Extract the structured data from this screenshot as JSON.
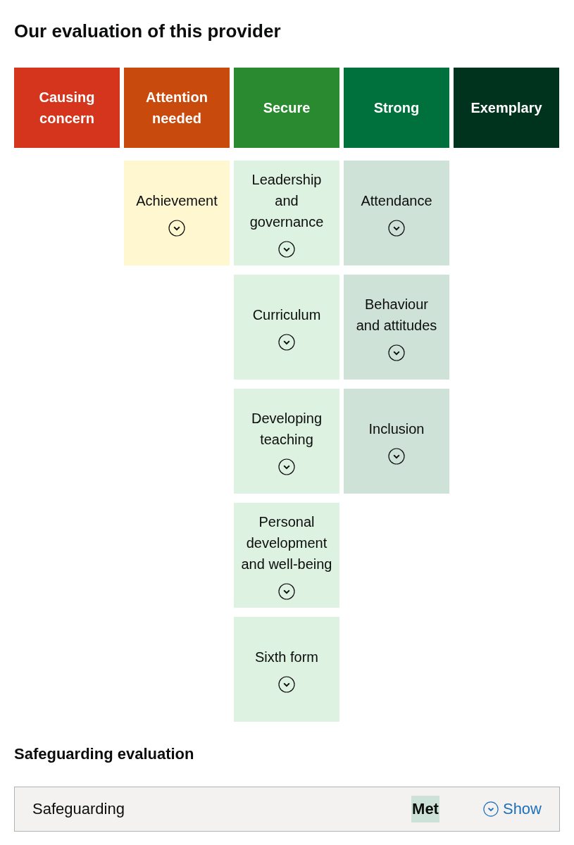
{
  "title": "Our evaluation of this provider",
  "grades": [
    {
      "label": "Causing concern",
      "color": "#d4351c"
    },
    {
      "label": "Attention needed",
      "color": "#c94a0d",
      "areas": [
        {
          "label": "Achievement",
          "color": "#fff7cf"
        }
      ]
    },
    {
      "label": "Secure",
      "color": "#298a2f",
      "areas": [
        {
          "label": "Leadership and governance",
          "color": "#ddf2e0"
        },
        {
          "label": "Curriculum",
          "color": "#ddf2e0"
        },
        {
          "label": "Developing teaching",
          "color": "#ddf2e0"
        },
        {
          "label": "Personal development and well-being",
          "color": "#ddf2e0"
        },
        {
          "label": "Sixth form",
          "color": "#ddf2e0"
        }
      ]
    },
    {
      "label": "Strong",
      "color": "#00703c",
      "areas": [
        {
          "label": "Attendance",
          "color": "#cee2d8"
        },
        {
          "label": "Behaviour and attitudes",
          "color": "#cee2d8"
        },
        {
          "label": "Inclusion",
          "color": "#cee2d8"
        }
      ]
    },
    {
      "label": "Exemplary",
      "color": "#00331d"
    }
  ],
  "safeguarding": {
    "heading": "Safeguarding evaluation",
    "label": "Safeguarding",
    "result": "Met",
    "toggle": "Show"
  }
}
